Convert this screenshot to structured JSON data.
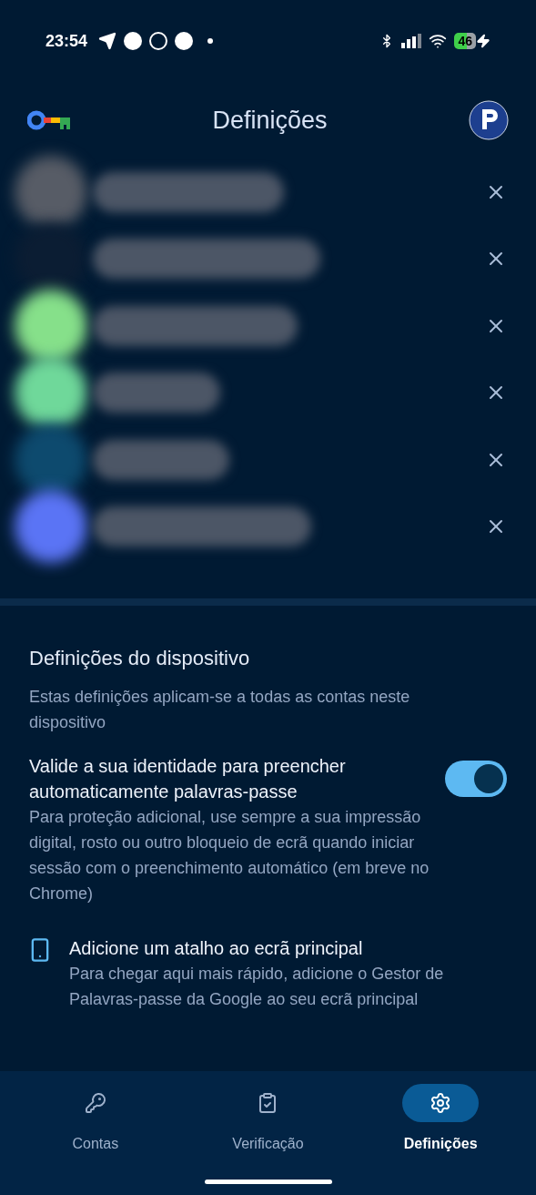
{
  "status_bar": {
    "time": "23:54",
    "battery": "46"
  },
  "header": {
    "title": "Definições"
  },
  "accounts": [
    {
      "color": "#575c66"
    },
    {
      "color": "#0b1d33"
    },
    {
      "color": "#86e08a"
    },
    {
      "color": "#6fd89a"
    },
    {
      "color": "#0d4a6e"
    },
    {
      "color": "#5a74f5"
    }
  ],
  "device_settings": {
    "title": "Definições do dispositivo",
    "subtitle": "Estas definições aplicam-se a todas as contas neste dispositivo"
  },
  "settings": [
    {
      "kind": "toggle",
      "title": "Valide a sua identidade para preencher automaticamente palavras-passe",
      "description": "Para proteção adicional, use sempre a sua impressão digital, rosto ou outro bloqueio de ecrã quando iniciar sessão com o preenchimento automático (em breve no Chrome)",
      "on": true
    },
    {
      "kind": "shortcut",
      "title": "Adicione um atalho ao ecrã principal",
      "description": "Para chegar aqui mais rápido, adicione o Gestor de Palavras-passe da Google ao seu ecrã principal"
    }
  ],
  "nav": [
    {
      "kind": "key",
      "label": "Contas",
      "selected": false
    },
    {
      "kind": "clipboard",
      "label": "Verificação",
      "selected": false
    },
    {
      "kind": "gear",
      "label": "Definições",
      "selected": true
    }
  ]
}
